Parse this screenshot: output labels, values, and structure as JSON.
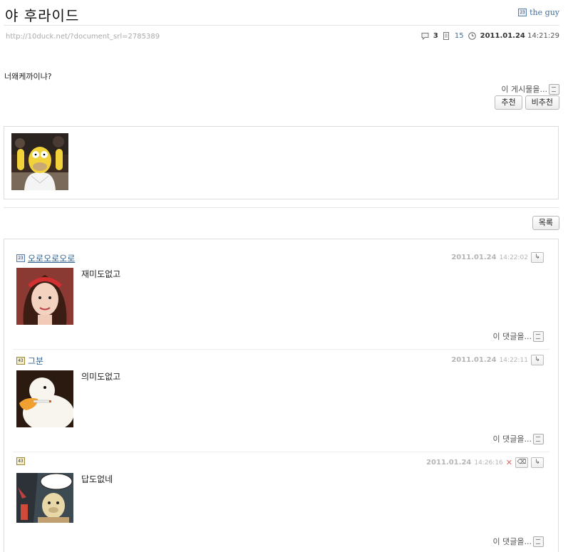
{
  "post": {
    "title": "야 후라이드",
    "author": "the guy",
    "author_level": "23",
    "url": "http://10duck.net/?document_srl=2785389",
    "comment_count": "3",
    "view_count": "15",
    "date": "2011.01.24",
    "time": "14:21:29",
    "content": "너왜케까이냐?",
    "report_label": "이 게시물을...",
    "recommend_label": "추천",
    "unrecommend_label": "비추천"
  },
  "list_button_label": "목록",
  "comments": [
    {
      "level": "23",
      "nick": "오로오로오로",
      "date": "2011.01.24",
      "time": "14:22:02",
      "text": "재미도없고",
      "reply_label": "이 댓글을..."
    },
    {
      "level": "43",
      "nick": "그분",
      "date": "2011.01.24",
      "time": "14:22:11",
      "text": "의미도없고",
      "reply_label": "이 댓글을..."
    },
    {
      "level": "43",
      "nick": "",
      "date": "2011.01.24",
      "time": "14:26:16",
      "text": "답도없네",
      "reply_label": "이 댓글을..."
    }
  ],
  "icons": {
    "comment": "speech-bubble-icon",
    "views": "document-icon",
    "clock": "clock-icon",
    "reply": "reply-arrow-icon",
    "delete": "delete-x-icon",
    "edit": "eraser-icon",
    "report": "report-icon"
  }
}
